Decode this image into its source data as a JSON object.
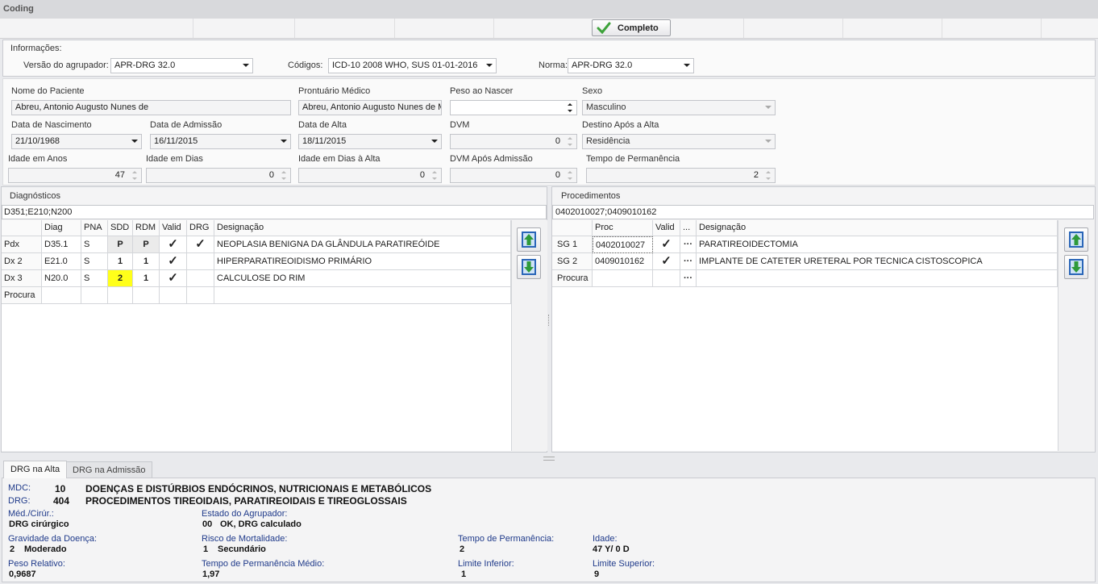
{
  "window": {
    "title": "Coding"
  },
  "toolbar": {
    "complete_label": "Completo"
  },
  "info": {
    "section_label": "Informações:",
    "grouper_label": "Versão do agrupador:",
    "grouper_value": "APR-DRG 32.0",
    "codes_label": "Códigos:",
    "codes_value": "ICD-10 2008 WHO, SUS 01-01-2016",
    "norm_label": "Norma:",
    "norm_value": "APR-DRG 32.0"
  },
  "patient": {
    "name_label": "Nome do Paciente",
    "name_value": "Abreu, Antonio Augusto Nunes de",
    "record_label": "Prontuário Médico",
    "record_value": "Abreu, Antonio Augusto Nunes de M",
    "birthweight_label": "Peso ao Nascer",
    "birthweight_value": "",
    "sex_label": "Sexo",
    "sex_value": "Masculino",
    "dob_label": "Data de Nascimento",
    "dob_value": "21/10/1968",
    "admission_label": "Data de Admissão",
    "admission_value": "16/11/2015",
    "discharge_label": "Data de Alta",
    "discharge_value": "18/11/2015",
    "dvm_label": "DVM",
    "dvm_value": "0",
    "destination_label": "Destino Após a Alta",
    "destination_value": "Residência",
    "age_years_label": "Idade em Anos",
    "age_years_value": "47",
    "age_days_label": "Idade em Dias",
    "age_days_value": "0",
    "age_days_discharge_label": "Idade em Dias à Alta",
    "age_days_discharge_value": "0",
    "dvm_after_label": "DVM Após Admissão",
    "dvm_after_value": "0",
    "stay_label": "Tempo de Permanência",
    "stay_value": "2"
  },
  "diagnoses": {
    "title": "Diagnósticos",
    "codes": "D351;E210;N200",
    "headers": [
      "",
      "Diag",
      "PNA",
      "SDD",
      "RDM",
      "Valid",
      "DRG",
      "Designação"
    ],
    "rows": [
      {
        "type": "Pdx",
        "diag": "D35.1",
        "pna": "S",
        "sdd": "P",
        "rdm": "P",
        "valid": "✓",
        "drg": "✓",
        "desc": "NEOPLASIA BENIGNA DA GLÂNDULA PARATIREÓIDE"
      },
      {
        "type": "Dx 2",
        "diag": "E21.0",
        "pna": "S",
        "sdd": "1",
        "rdm": "1",
        "valid": "✓",
        "drg": "",
        "desc": "HIPERPARATIREOIDISMO PRIMÁRIO"
      },
      {
        "type": "Dx 3",
        "diag": "N20.0",
        "pna": "S",
        "sdd": "2",
        "rdm": "1",
        "valid": "✓",
        "drg": "",
        "desc": "CALCULOSE DO RIM"
      },
      {
        "type": "Procura",
        "diag": "",
        "pna": "",
        "sdd": "",
        "rdm": "",
        "valid": "",
        "drg": "",
        "desc": ""
      }
    ]
  },
  "procedures": {
    "title": "Procedimentos",
    "codes": "0402010027;0409010162",
    "headers": [
      "",
      "Proc",
      "Valid",
      "...",
      "Designação"
    ],
    "rows": [
      {
        "type": "SG 1",
        "proc": "0402010027",
        "valid": "✓",
        "more": "···",
        "desc": "PARATIREOIDECTOMIA"
      },
      {
        "type": "SG 2",
        "proc": "0409010162",
        "valid": "✓",
        "more": "···",
        "desc": "IMPLANTE DE CATETER URETERAL POR TECNICA CISTOSCOPICA"
      },
      {
        "type": "Procura",
        "proc": "",
        "valid": "",
        "more": "···",
        "desc": ""
      }
    ]
  },
  "tabs": [
    {
      "label": "DRG na Alta"
    },
    {
      "label": "DRG na Admissão"
    }
  ],
  "result": {
    "mdc_label": "MDC:",
    "mdc_code": "10",
    "mdc_desc": "DOENÇAS E DISTÚRBIOS ENDÓCRINOS, NUTRICIONAIS E METABÓLICOS",
    "drg_label": "DRG:",
    "drg_code": "404",
    "drg_desc": "PROCEDIMENTOS TIREOIDAIS, PARATIREOIDAIS E TIREOGLOSSAIS",
    "medcir_label": "Méd./Cirúr.:",
    "medcir_value": "DRG cirúrgico",
    "grouper_state_label": "Estado do Agrupador:",
    "grouper_state_code": "00",
    "grouper_state_value": "OK, DRG calculado",
    "severity_label": "Gravidade da Doença:",
    "severity_code": "2",
    "severity_value": "Moderado",
    "mortality_label": "Risco de Mortalidade:",
    "mortality_code": "1",
    "mortality_value": "Secundário",
    "los_label": "Tempo de Permanência:",
    "los_value": "2",
    "age_label": "Idade:",
    "age_value": "47 Y/ 0 D",
    "weight_label": "Peso Relativo:",
    "weight_value": "0,9687",
    "avg_los_label": "Tempo de Permanência Médio:",
    "avg_los_value": "1,97",
    "lower_label": "Limite Inferior:",
    "lower_value": "1",
    "upper_label": "Limite Superior:",
    "upper_value": "9"
  },
  "colors": {
    "accent_label": "#1f3a8a",
    "highlight_yellow": "#ffff1a",
    "check_green": "#3da23a",
    "arrow_green": "#2e9a3a",
    "arrow_blue": "#2a66b8"
  }
}
